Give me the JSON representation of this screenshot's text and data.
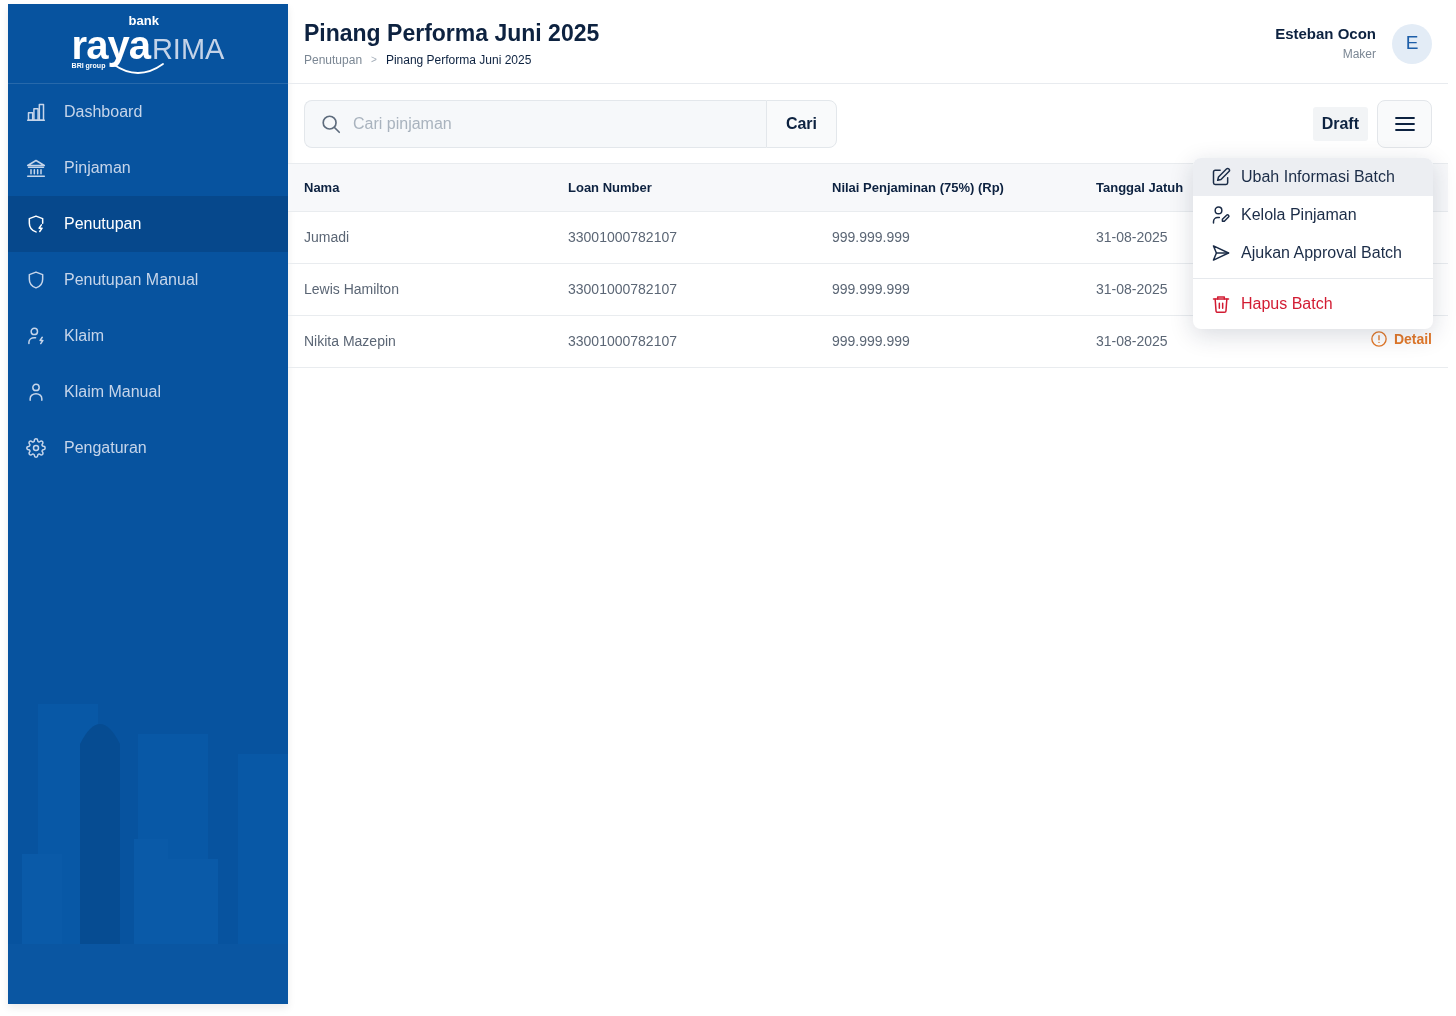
{
  "sidebar": {
    "logo": {
      "top": "bank",
      "word": "raya",
      "suffix": "RIMA",
      "tagline": "BRI group"
    },
    "items": [
      {
        "label": "Dashboard",
        "selected": false
      },
      {
        "label": "Pinjaman",
        "selected": false
      },
      {
        "label": "Penutupan",
        "selected": true
      },
      {
        "label": "Penutupan Manual",
        "selected": false
      },
      {
        "label": "Klaim",
        "selected": false
      },
      {
        "label": "Klaim Manual",
        "selected": false
      },
      {
        "label": "Pengaturan",
        "selected": false
      }
    ]
  },
  "header": {
    "title": "Pinang Performa Juni 2025",
    "breadcrumb": [
      {
        "label": "Penutupan",
        "current": false
      },
      {
        "label": "Pinang Performa Juni 2025",
        "current": true
      }
    ],
    "breadcrumb_separator": ">",
    "user": {
      "name": "Esteban Ocon",
      "role": "Maker",
      "initial": "E"
    }
  },
  "toolbar": {
    "search": {
      "placeholder": "Cari pinjaman",
      "button": "Cari"
    },
    "status_badge": "Draft",
    "menu": {
      "sections": [
        [
          {
            "label": "Ubah Informasi Batch",
            "kind": "default",
            "selected": true
          },
          {
            "label": "Kelola Pinjaman",
            "kind": "default",
            "selected": false
          },
          {
            "label": "Ajukan Approval Batch",
            "kind": "default",
            "selected": false
          }
        ],
        [
          {
            "label": "Hapus Batch",
            "kind": "danger",
            "selected": false
          }
        ]
      ]
    }
  },
  "table": {
    "columns": [
      "Nama",
      "Loan Number",
      "Nilai Penjaminan (75%) (Rp)",
      "Tanggal Jatuh"
    ],
    "rows": [
      {
        "cells": [
          "Jumadi",
          "33001000782107",
          "999.999.999",
          "31-08-2025"
        ]
      },
      {
        "cells": [
          "Lewis Hamilton",
          "33001000782107",
          "999.999.999",
          "31-08-2025"
        ]
      },
      {
        "cells": [
          "Nikita Mazepin",
          "33001000782107",
          "999.999.999",
          "31-08-2025"
        ],
        "action": "Detail"
      }
    ]
  }
}
